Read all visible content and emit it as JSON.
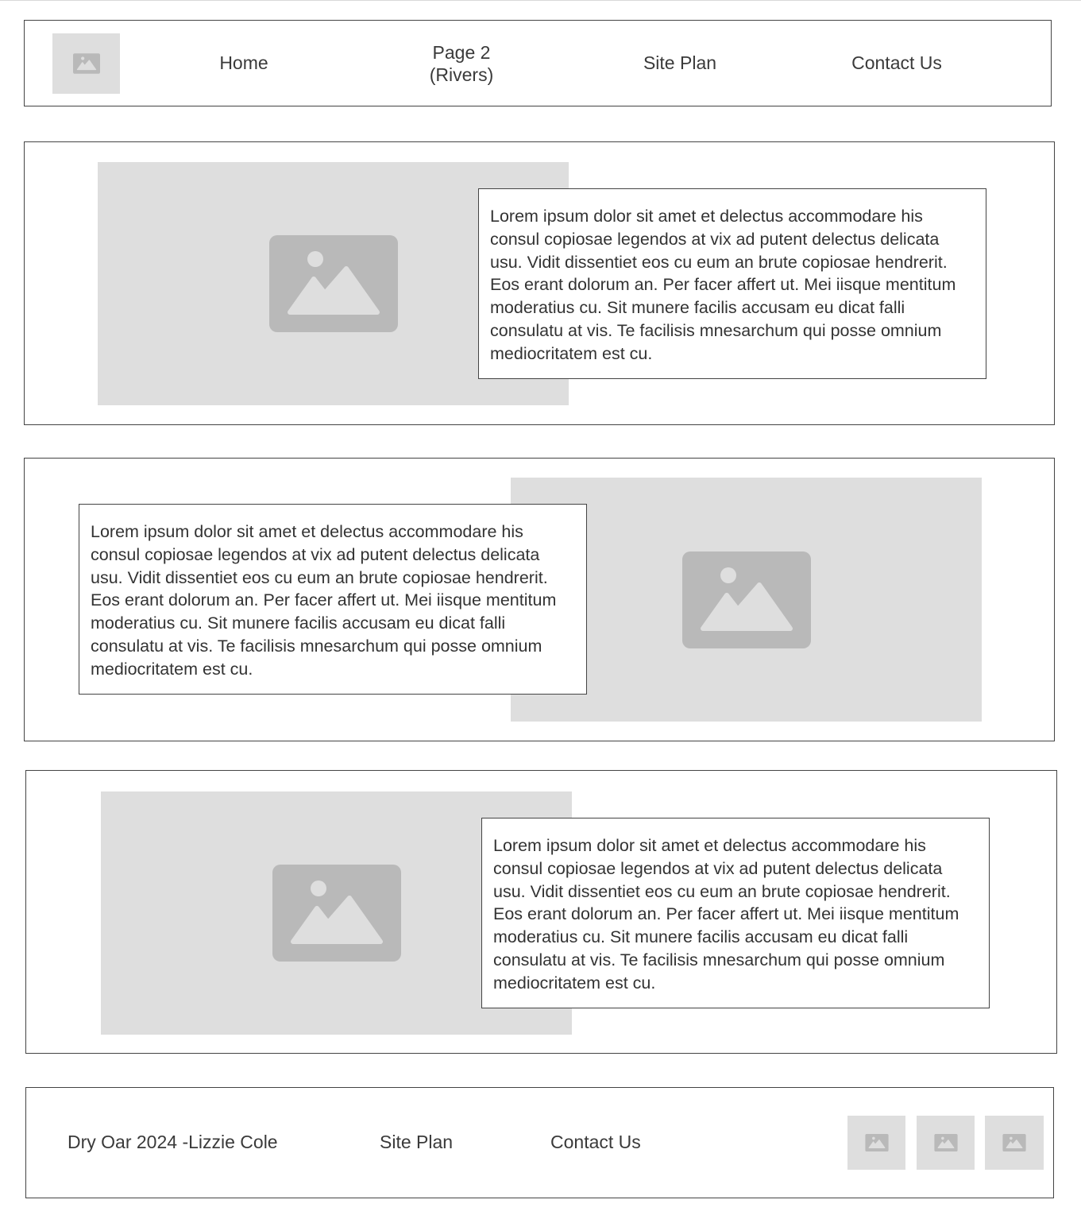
{
  "header": {
    "logo_icon": "image-placeholder-icon",
    "nav": [
      {
        "label_line1": "Home",
        "label_line2": ""
      },
      {
        "label_line1": "Page 2",
        "label_line2": "(Rivers)"
      },
      {
        "label_line1": "Site Plan",
        "label_line2": ""
      },
      {
        "label_line1": "Contact Us",
        "label_line2": ""
      }
    ]
  },
  "sections": [
    {
      "image_icon": "image-placeholder-icon",
      "text": "Lorem ipsum dolor sit amet et delectus accommodare his consul copiosae legendos at vix ad putent delectus delicata usu. Vidit dissentiet eos cu eum an brute copiosae hendrerit. Eos erant dolorum an. Per facer affert ut. Mei iisque mentitum moderatius cu. Sit munere facilis accusam eu dicat falli consulatu at vis. Te facilisis mnesarchum qui posse omnium mediocritatem est cu."
    },
    {
      "image_icon": "image-placeholder-icon",
      "text": "Lorem ipsum dolor sit amet et delectus accommodare his consul copiosae legendos at vix ad putent delectus delicata usu. Vidit dissentiet eos cu eum an brute copiosae hendrerit. Eos erant dolorum an. Per facer affert ut. Mei iisque mentitum moderatius cu. Sit munere facilis accusam eu dicat falli consulatu at vis. Te facilisis mnesarchum qui posse omnium mediocritatem est cu."
    },
    {
      "image_icon": "image-placeholder-icon",
      "text": "Lorem ipsum dolor sit amet et delectus accommodare his consul copiosae legendos at vix ad putent delectus delicata usu. Vidit dissentiet eos cu eum an brute copiosae hendrerit. Eos erant dolorum an. Per facer affert ut. Mei iisque mentitum moderatius cu. Sit munere facilis accusam eu dicat falli consulatu at vis. Te facilisis mnesarchum qui posse omnium mediocritatem est cu."
    }
  ],
  "footer": {
    "copyright": "Dry Oar 2024 -Lizzie Cole",
    "site_plan": "Site Plan",
    "contact_us": "Contact Us",
    "social_icons": [
      "image-placeholder-icon",
      "image-placeholder-icon",
      "image-placeholder-icon"
    ]
  },
  "colors": {
    "placeholder_bg": "#dedede",
    "placeholder_icon": "#b9b9b9",
    "border": "#444444",
    "text": "#333333"
  }
}
